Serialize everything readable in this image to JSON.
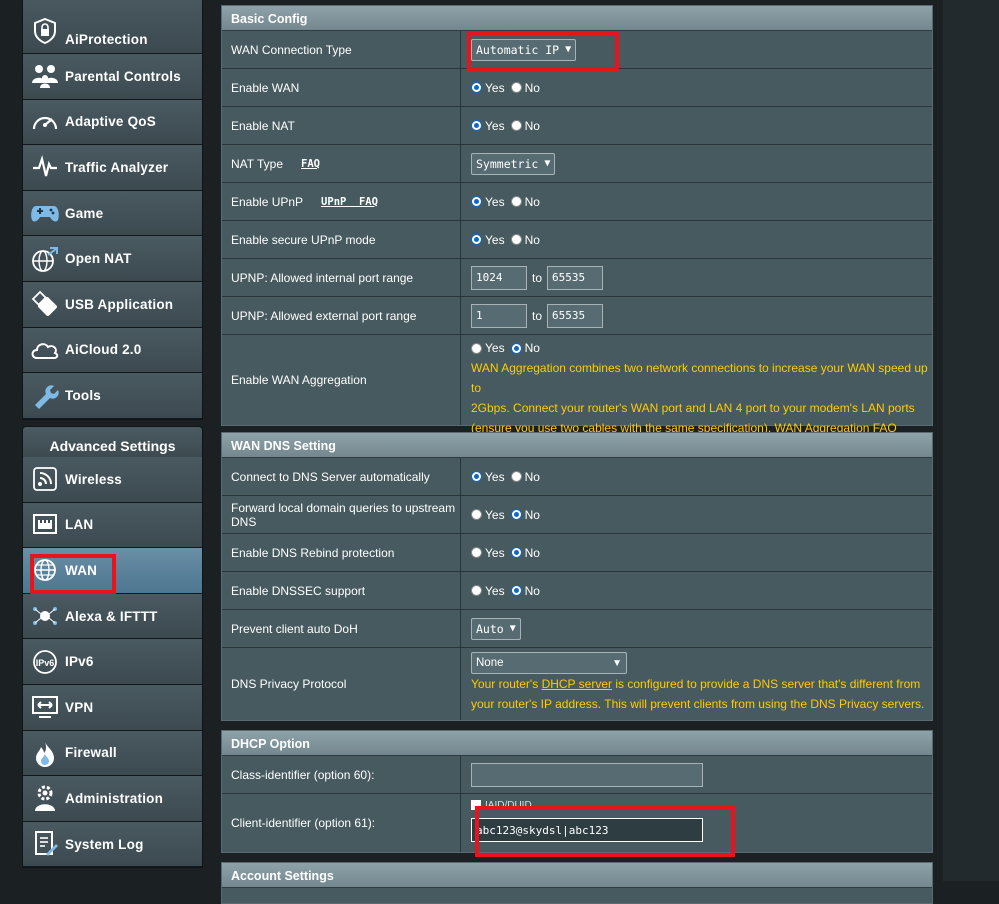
{
  "sidebar": {
    "items": [
      {
        "label": "AiProtection",
        "icon": "lock-shield-icon"
      },
      {
        "label": "Parental Controls",
        "icon": "family-icon"
      },
      {
        "label": "Adaptive QoS",
        "icon": "speedometer-icon"
      },
      {
        "label": "Traffic Analyzer",
        "icon": "pulse-icon"
      },
      {
        "label": "Game",
        "icon": "gamepad-icon"
      },
      {
        "label": "Open NAT",
        "icon": "globe-network-icon"
      },
      {
        "label": "USB Application",
        "icon": "usb-icon"
      },
      {
        "label": "AiCloud 2.0",
        "icon": "cloud-icon"
      },
      {
        "label": "Tools",
        "icon": "wrench-icon"
      }
    ],
    "advanced_title": "Advanced Settings",
    "advanced_items": [
      {
        "label": "Wireless",
        "icon": "wifi-icon"
      },
      {
        "label": "LAN",
        "icon": "lan-icon"
      },
      {
        "label": "WAN",
        "icon": "globe-icon"
      },
      {
        "label": "Alexa & IFTTT",
        "icon": "alexa-icon"
      },
      {
        "label": "IPv6",
        "icon": "ipv6-icon"
      },
      {
        "label": "VPN",
        "icon": "vpn-icon"
      },
      {
        "label": "Firewall",
        "icon": "fire-icon"
      },
      {
        "label": "Administration",
        "icon": "gear-person-icon"
      },
      {
        "label": "System Log",
        "icon": "log-icon"
      }
    ]
  },
  "basic": {
    "title": "Basic Config",
    "wan_type_label": "WAN Connection Type",
    "wan_type_value": "Automatic IP",
    "enable_wan_label": "Enable WAN",
    "enable_nat_label": "Enable NAT",
    "nat_type_label": "NAT Type",
    "nat_faq": "FAQ",
    "nat_type_value": "Symmetric",
    "upnp_label": "Enable UPnP",
    "upnp_faq": "UPnP  FAQ",
    "secure_upnp_label": "Enable secure UPnP mode",
    "int_range_label": "UPNP: Allowed internal port range",
    "int_from": "1024",
    "int_to": "65535",
    "ext_range_label": "UPNP: Allowed external port range",
    "ext_from": "1",
    "ext_to": "65535",
    "to": "to",
    "agg_label": "Enable WAN Aggregation",
    "agg_note_1": "WAN Aggregation combines two network connections to increase your WAN speed up to",
    "agg_note_2": "2Gbps. Connect your router's WAN port and LAN 4 port to your modem's LAN ports",
    "agg_note_3": "(ensure you use two cables with the same specification). ",
    "agg_faq": "WAN Aggregation FAQ"
  },
  "radio": {
    "yes": "Yes",
    "no": "No"
  },
  "dns": {
    "title": "WAN DNS Setting",
    "auto_label": "Connect to DNS Server automatically",
    "forward_label": "Forward local domain queries to upstream DNS",
    "rebind_label": "Enable DNS Rebind protection",
    "dnssec_label": "Enable DNSSEC support",
    "doh_label": "Prevent client auto DoH",
    "doh_value": "Auto",
    "privacy_label": "DNS Privacy Protocol",
    "privacy_value": "None",
    "note_1a": "Your router's ",
    "note_link": "DHCP server",
    "note_1b": " is configured to provide a DNS server that's different from",
    "note_2": "your router's IP address. This will prevent clients from using the DNS Privacy servers."
  },
  "dhcp": {
    "title": "DHCP Option",
    "class_label": "Class-identifier (option 60):",
    "class_value": "",
    "client_label": "Client-identifier (option 61):",
    "iaid_label": "IAID/DUID",
    "client_value": "abc123@skydsl|abc123"
  },
  "account": {
    "title": "Account Settings"
  }
}
